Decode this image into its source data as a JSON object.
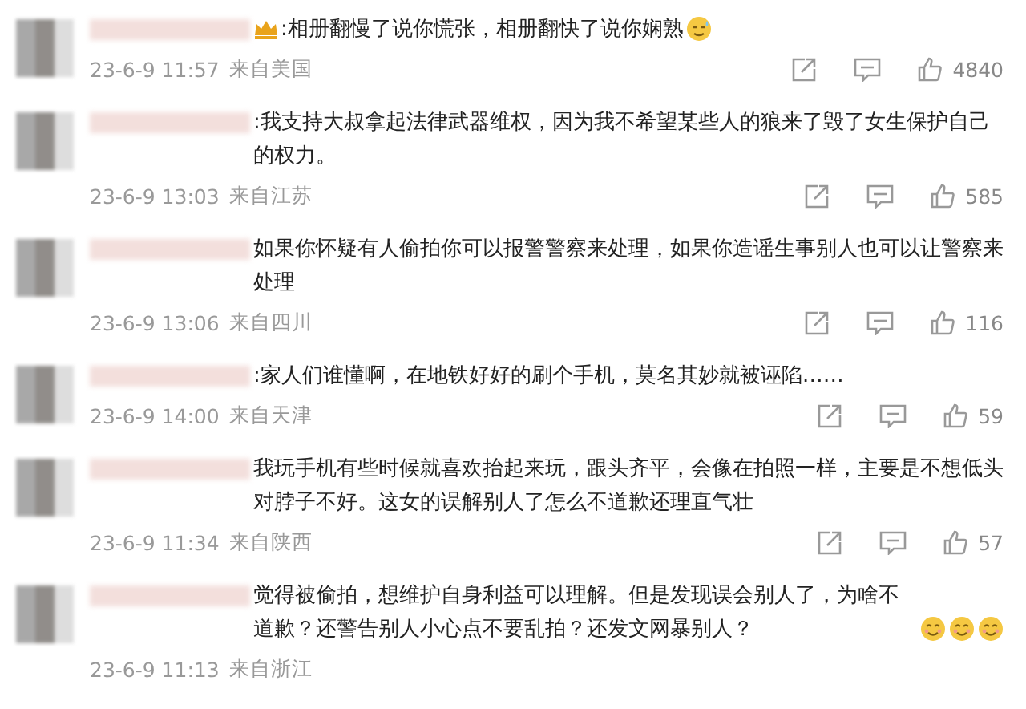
{
  "comments": [
    {
      "crown_badge": true,
      "text": ":相册翻慢了说你慌张，相册翻快了说你娴熟",
      "emojis": [
        {
          "kind": "sweat"
        }
      ],
      "time": "23-6-9 11:57",
      "location": "来自美国",
      "likes": "4840"
    },
    {
      "crown_badge": false,
      "text": ":我支持大叔拿起法律武器维权，因为我不希望某些人的狼来了毁了女生保护自己的权力。",
      "time": "23-6-9 13:03",
      "location": "来自江苏",
      "likes": "585"
    },
    {
      "crown_badge": false,
      "text": "如果你怀疑有人偷拍你可以报警警察来处理，如果你造谣生事别人也可以让警察来处理",
      "time": "23-6-9 13:06",
      "location": "来自四川",
      "likes": "116"
    },
    {
      "crown_badge": false,
      "text": ":家人们谁懂啊，在地铁好好的刷个手机，莫名其妙就被诬陷……",
      "time": "23-6-9 14:00",
      "location": "来自天津",
      "likes": "59"
    },
    {
      "crown_badge": false,
      "text": "我玩手机有些时候就喜欢抬起来玩，跟头齐平，会像在拍照一样，主要是不想低头对脖子不好。这女的误解别人了怎么不道歉还理直气壮",
      "time": "23-6-9 11:34",
      "location": "来自陕西",
      "likes": "57"
    },
    {
      "crown_badge": false,
      "text": "觉得被偷拍，想维护自身利益可以理解。但是发现误会别人了，为啥不道歉？还警告别人小心点不要乱拍？还发文网暴别人？",
      "emojis": [
        {
          "kind": "smirk"
        },
        {
          "kind": "smirk"
        },
        {
          "kind": "smirk"
        }
      ],
      "time": "23-6-9 11:13",
      "location": "来自浙江"
    }
  ]
}
